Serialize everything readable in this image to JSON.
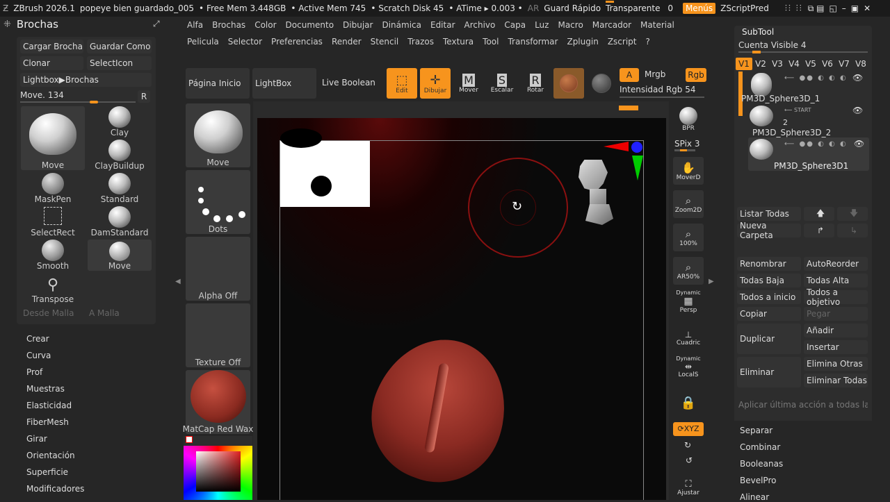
{
  "topbar": {
    "app": "ZBrush 2026.1",
    "file": "popeye bien guardado_005",
    "freemem": "• Free Mem 3.448GB",
    "activemem": "• Active Mem 745",
    "scratch": "• Scratch Disk 45",
    "atime": "• ATime ▸ 0.003 •",
    "ar": "AR",
    "quicksave": "Guard Rápido",
    "transparent": "Transparente",
    "transparent_val": "0",
    "menus": "Menús",
    "zscript": "ZScriptPred"
  },
  "menu_row1": [
    "Alfa",
    "Brochas",
    "Color",
    "Documento",
    "Dibujar",
    "Dinámica",
    "Editar",
    "Archivo",
    "Capa",
    "Luz",
    "Macro",
    "Marcador",
    "Material"
  ],
  "menu_row2": [
    "Pelicula",
    "Selector",
    "Preferencias",
    "Render",
    "Stencil",
    "Trazos",
    "Textura",
    "Tool",
    "Transformar",
    "Zplugin",
    "Zscript",
    "?"
  ],
  "brushes": {
    "title": "Brochas",
    "load": "Cargar Brocha",
    "save": "Guardar Como",
    "clone": "Clonar",
    "selecticon": "SelectIcon",
    "lightbox": "Lightbox▶Brochas",
    "current": "Move.",
    "current_val": "134",
    "r": "R",
    "items": [
      "Move",
      "Clay",
      "ClayBuildup",
      "MaskPen",
      "Standard",
      "SelectRect",
      "DamStandard",
      "Smooth",
      "Move",
      "Transpose"
    ],
    "from_mesh": "Desde Malla",
    "to_mesh": "A Malla"
  },
  "leftmenu": [
    "Crear",
    "Curva",
    "Prof",
    "Muestras",
    "Elasticidad",
    "FiberMesh",
    "Girar",
    "Orientación",
    "Superficie",
    "Modificadores"
  ],
  "shelf": {
    "home": "Página Inicio",
    "lightbox": "LightBox",
    "live_boolean": "Live Boolean",
    "edit": "Edit",
    "draw": "Dibujar",
    "move": "Mover",
    "scale": "Escalar",
    "rotate": "Rotar",
    "a": "A",
    "mrgb": "Mrgb",
    "rgb": "Rgb",
    "rgb_intensity": "Intensidad Rgb",
    "rgb_intensity_val": "54"
  },
  "tray": {
    "move": "Move",
    "dots": "Dots",
    "alpha_off": "Alpha Off",
    "texture_off": "Texture Off",
    "matcap": "MatCap Red Wax"
  },
  "rightshelf": {
    "bpr": "BPR",
    "spix": "SPix",
    "spix_val": "3",
    "moverd": "MoverD",
    "zoom2d": "Zoom2D",
    "z100": "100%",
    "ar50": "AR50%",
    "dynamic": "Dynamic",
    "persp": "Persp",
    "cuadric": "Cuadric",
    "dynamic2": "Dynamic",
    "locals": "LocalS",
    "xyz": "⟳XYZ",
    "ajustar": "Ajustar"
  },
  "subtool": {
    "title": "SubTool",
    "visible": "Cuenta Visible",
    "visible_val": "4",
    "versions": [
      "V1",
      "V2",
      "V3",
      "V4",
      "V5",
      "V6",
      "V7",
      "V8"
    ],
    "items": [
      "PM3D_Sphere3D_1",
      "PM3D_Sphere3D_2",
      "PM3D_Sphere3D1"
    ],
    "start": "START",
    "two": "2",
    "list_all": "Listar Todas",
    "new_folder": "Nueva Carpeta",
    "rename": "Renombrar",
    "autoreorder": "AutoReorder",
    "all_low": "Todas Baja",
    "all_high": "Todas Alta",
    "all_start": "Todos a inicio",
    "all_target": "Todos a objetivo",
    "copy": "Copiar",
    "paste": "Pegar",
    "duplicate": "Duplicar",
    "add": "Añadir",
    "insert": "Insertar",
    "delete": "Eliminar",
    "delete_others": "Elimina Otras",
    "delete_all": "Eliminar Todas",
    "apply_last": "Aplicar última acción a todas las I",
    "split": "Separar",
    "merge": "Combinar",
    "booleans": "Booleanas",
    "bevelpro": "BevelPro",
    "align": "Alinear"
  }
}
